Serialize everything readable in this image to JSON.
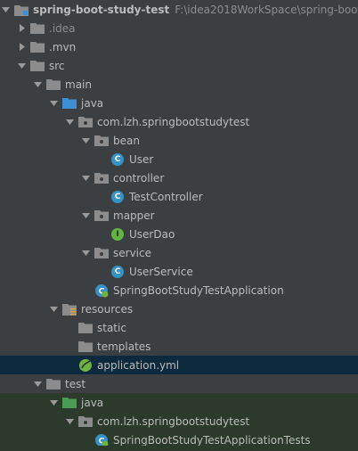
{
  "project": {
    "name": "spring-boot-study-test",
    "path": "F:\\idea2018WorkSpace\\spring-boot-"
  },
  "tree": {
    "idea": ".idea",
    "mvn": ".mvn",
    "src": "src",
    "main": "main",
    "java": "java",
    "package": "com.lzh.springbootstudytest",
    "bean": "bean",
    "user": "User",
    "controller": "controller",
    "test_controller": "TestController",
    "mapper": "mapper",
    "user_dao": "UserDao",
    "service": "service",
    "user_service": "UserService",
    "app_class": "SpringBootStudyTestApplication",
    "resources": "resources",
    "static": "static",
    "templates": "templates",
    "application_yml": "application.yml",
    "test": "test",
    "test_java": "java",
    "test_package": "com.lzh.springbootstudytest",
    "test_class": "SpringBootStudyTestApplicationTests"
  },
  "colors": {
    "folder": "#8c8c8c",
    "source_folder": "#3d8fd1",
    "test_folder": "#499c54",
    "selection": "#0d293e",
    "class_icon": "#3592c4",
    "interface_icon": "#62b543"
  }
}
